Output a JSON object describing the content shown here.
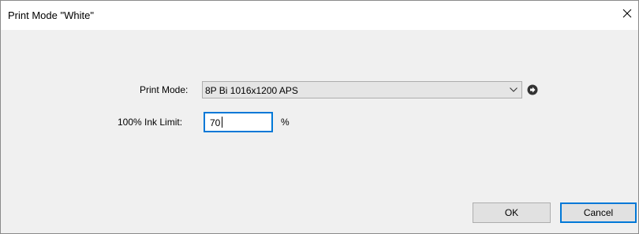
{
  "window": {
    "title": "Print Mode \"White\"",
    "close_icon": "close-icon"
  },
  "form": {
    "print_mode_label": "Print Mode:",
    "print_mode_value": "8P Bi 1016x1200 APS",
    "ink_limit_label": "100% Ink Limit:",
    "ink_limit_value": "70",
    "ink_limit_unit": "%"
  },
  "buttons": {
    "ok_label": "OK",
    "cancel_label": "Cancel"
  },
  "colors": {
    "focus_border": "#0078d7",
    "dialog_background": "#f0f0f0"
  }
}
